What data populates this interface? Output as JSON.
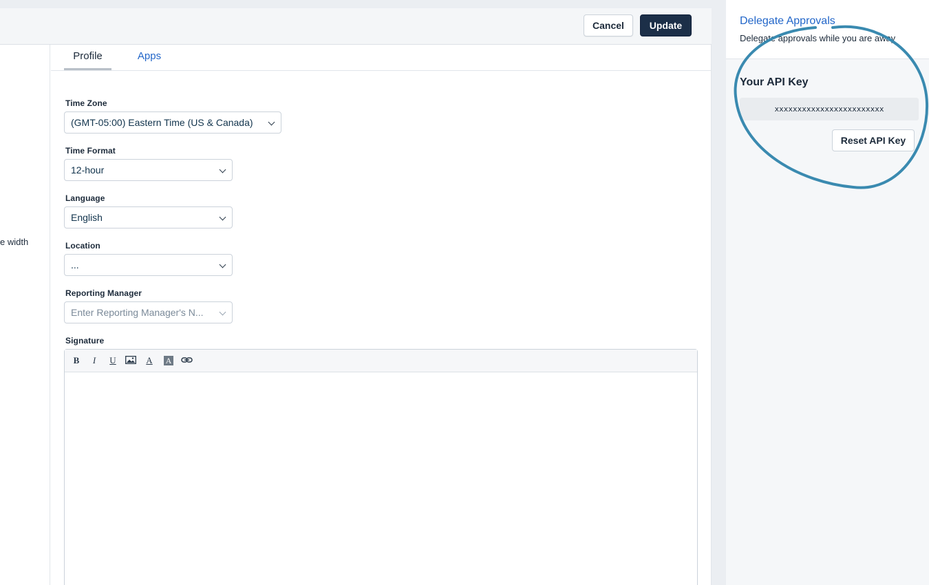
{
  "header": {
    "cancel_label": "Cancel",
    "update_label": "Update"
  },
  "left_strip": {
    "partial_text": "e width"
  },
  "tabs": [
    {
      "label": "Profile",
      "active": true
    },
    {
      "label": "Apps",
      "active": false
    }
  ],
  "form": {
    "time_zone": {
      "label": "Time Zone",
      "value": "(GMT-05:00) Eastern Time (US & Canada)"
    },
    "time_format": {
      "label": "Time Format",
      "value": "12-hour"
    },
    "language": {
      "label": "Language",
      "value": "English"
    },
    "location": {
      "label": "Location",
      "value": "..."
    },
    "reporting_manager": {
      "label": "Reporting Manager",
      "placeholder": "Enter Reporting Manager's N..."
    },
    "signature": {
      "label": "Signature",
      "toolbar": {
        "bold": "B",
        "italic": "I",
        "underline": "U",
        "font_color": "A",
        "background_color": "A"
      }
    }
  },
  "sidebar": {
    "delegate": {
      "link_label": "Delegate Approvals",
      "description": "Delegate approvals while you are away"
    },
    "api": {
      "title": "Your API Key",
      "key": "xxxxxxxxxxxxxxxxxxxxxxxx",
      "reset_label": "Reset API Key"
    }
  },
  "colors": {
    "primary_button": "#1c2f48",
    "link": "#2266c9",
    "annotation_circle": "#3a8ab0"
  }
}
